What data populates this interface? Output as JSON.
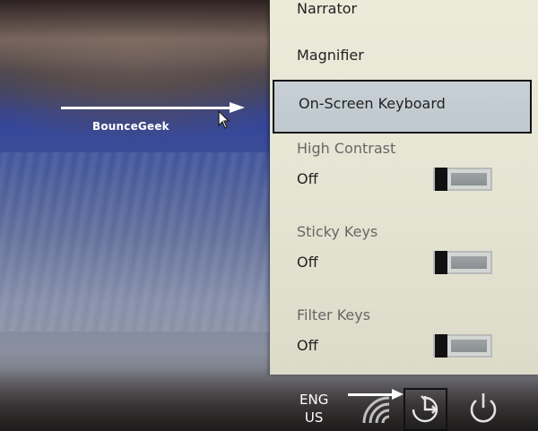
{
  "watermark": "BounceGeek",
  "menu": {
    "narrator": "Narrator",
    "magnifier": "Magnifier",
    "on_screen_keyboard": "On-Screen Keyboard"
  },
  "settings": {
    "high_contrast": {
      "label": "High Contrast",
      "state": "Off"
    },
    "sticky_keys": {
      "label": "Sticky Keys",
      "state": "Off"
    },
    "filter_keys": {
      "label": "Filter Keys",
      "state": "Off"
    }
  },
  "taskbar": {
    "language_top": "ENG",
    "language_bottom": "US"
  },
  "icons": {
    "network": "wifi-icon",
    "ease_of_access": "ease-of-access-icon",
    "power": "power-icon",
    "cursor": "mouse-cursor-icon"
  },
  "colors": {
    "panel_bg": "#e8e6d5",
    "highlight_bg": "#c4ccd3",
    "toggle_knob": "#111111"
  }
}
